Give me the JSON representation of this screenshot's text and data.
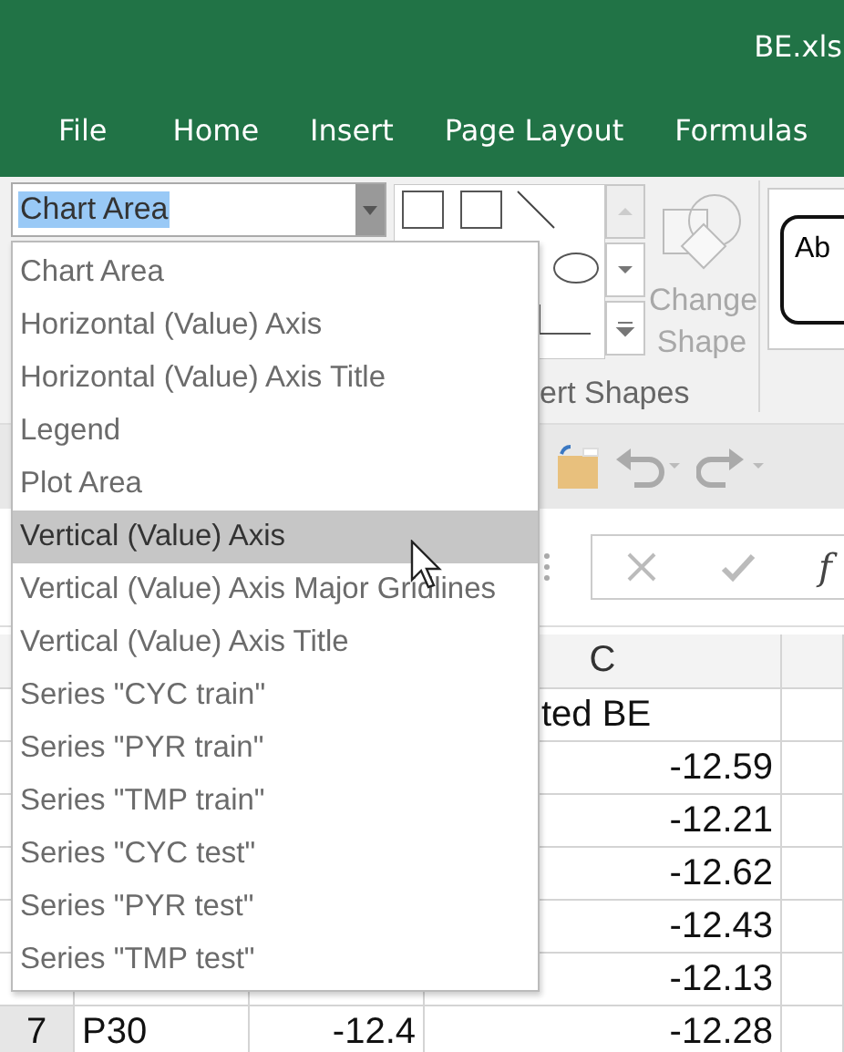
{
  "window": {
    "title": "BE.xls"
  },
  "ribbon_tabs": [
    "File",
    "Home",
    "Insert",
    "Page Layout",
    "Formulas"
  ],
  "name_box": {
    "value": "Chart Area"
  },
  "ribbon": {
    "change_shape": "Change Shape",
    "group_label": "ert Shapes",
    "style_preview": "Ab"
  },
  "formula_bar": {
    "function_label": "f"
  },
  "dropdown": {
    "items": [
      {
        "label": "Chart Area",
        "selected": false
      },
      {
        "label": "Horizontal (Value) Axis",
        "selected": false
      },
      {
        "label": "Horizontal (Value) Axis Title",
        "selected": false
      },
      {
        "label": "Legend",
        "selected": false
      },
      {
        "label": "Plot Area",
        "selected": false
      },
      {
        "label": "Vertical (Value) Axis",
        "selected": true
      },
      {
        "label": "Vertical (Value) Axis Major Gridlines",
        "selected": false
      },
      {
        "label": "Vertical (Value) Axis Title",
        "selected": false
      },
      {
        "label": "Series \"CYC train\"",
        "selected": false
      },
      {
        "label": "Series \"PYR train\"",
        "selected": false
      },
      {
        "label": "Series \"TMP train\"",
        "selected": false
      },
      {
        "label": "Series \"CYC test\"",
        "selected": false
      },
      {
        "label": "Series \"PYR test\"",
        "selected": false
      },
      {
        "label": "Series \"TMP test\"",
        "selected": false
      }
    ]
  },
  "sheet": {
    "column_header": "C",
    "rows": [
      {
        "c": "ted BE"
      },
      {
        "c": "-12.59"
      },
      {
        "c": "-12.21"
      },
      {
        "c": "-12.62"
      },
      {
        "c": "-12.43"
      },
      {
        "c": "-12.13"
      },
      {
        "number": "7",
        "a": "P30",
        "b": "-12.4",
        "c": "-12.28"
      }
    ]
  }
}
